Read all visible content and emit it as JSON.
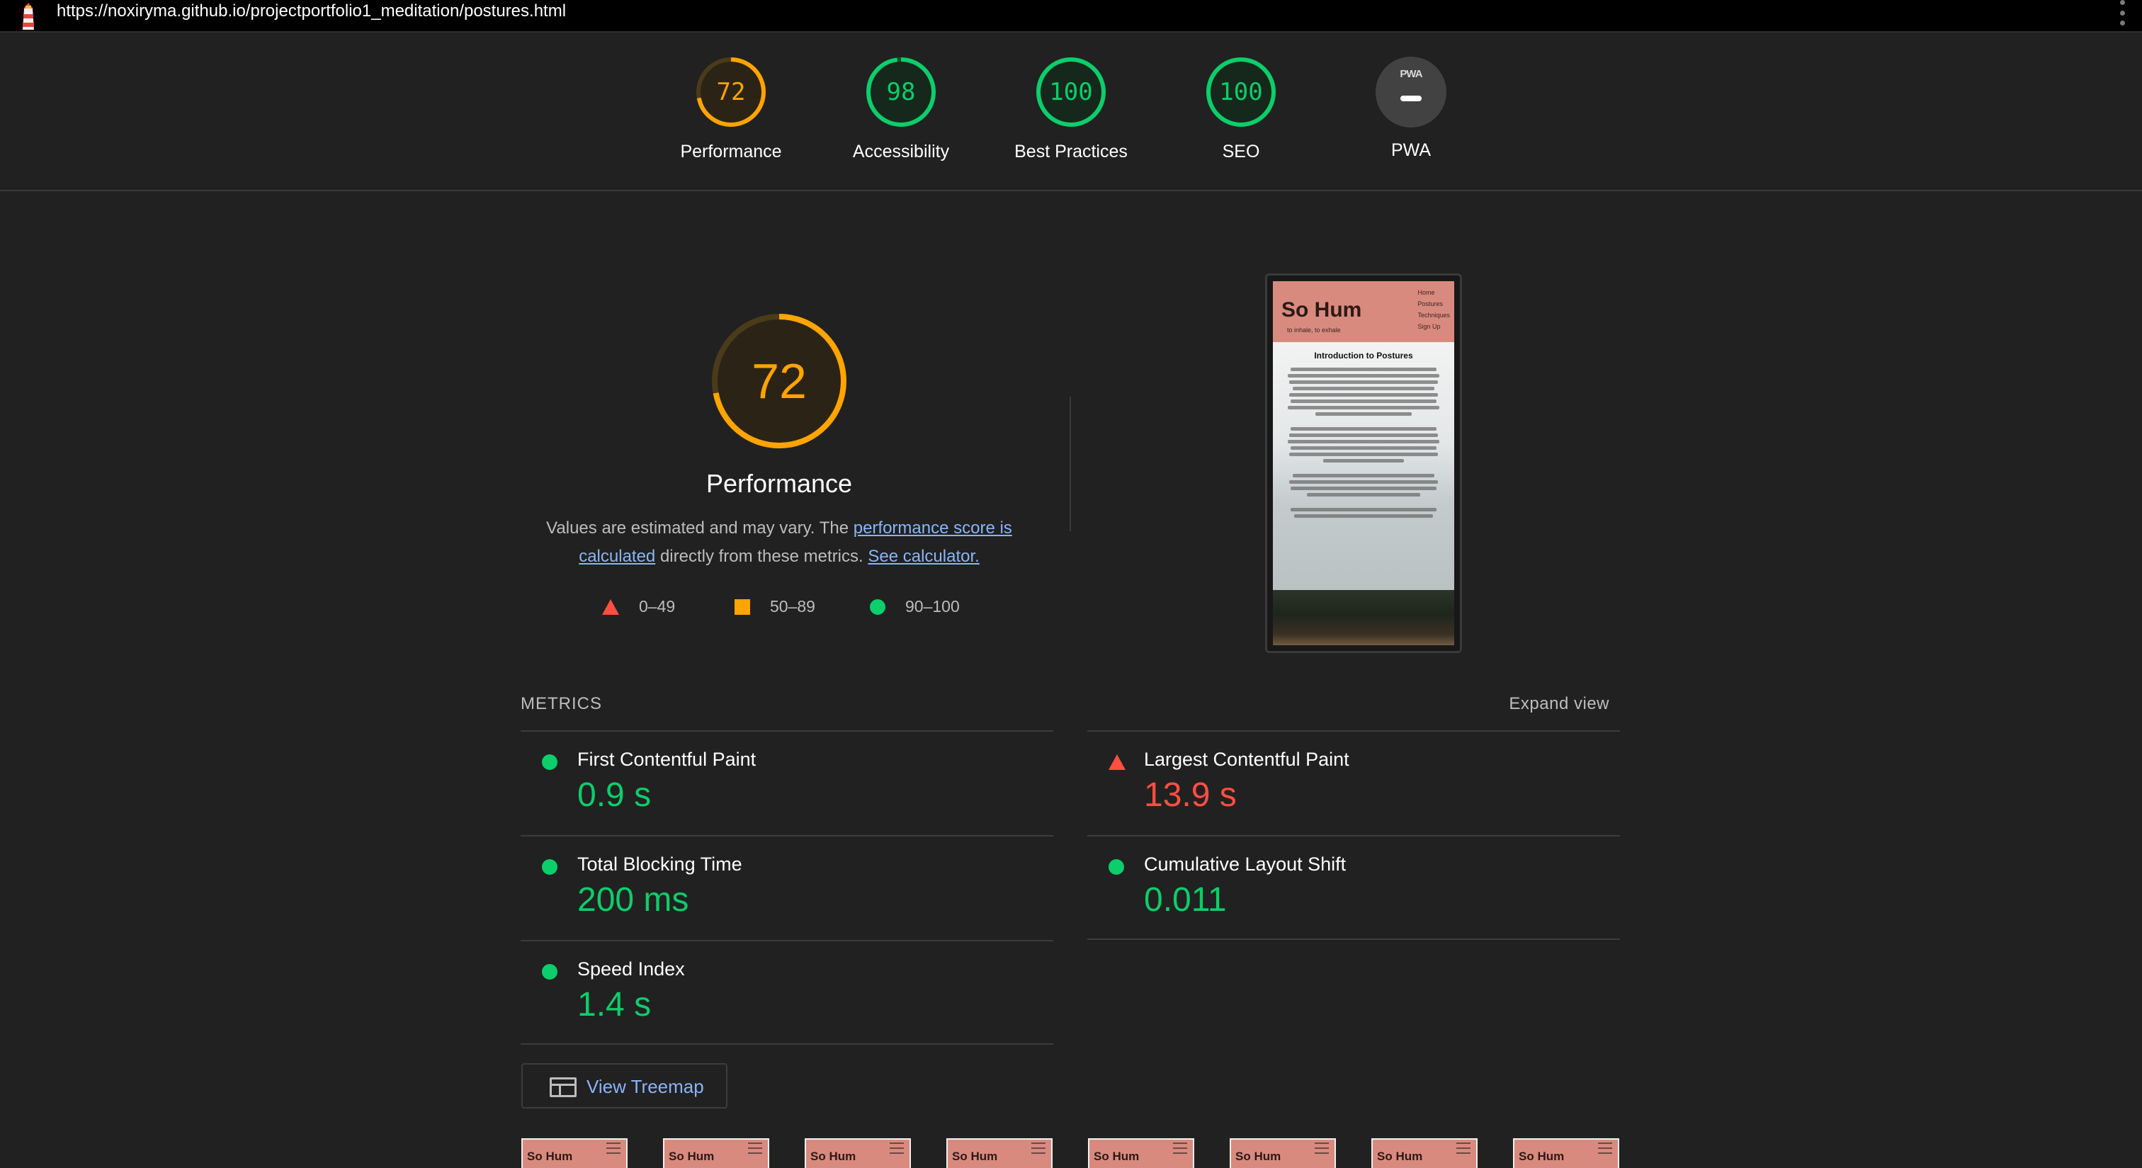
{
  "browser": {
    "url": "https://noxiryma.github.io/projectportfolio1_meditation/postures.html"
  },
  "categories": [
    {
      "label": "Performance",
      "score": "72",
      "color": "#ffa400",
      "fraction": 0.72
    },
    {
      "label": "Accessibility",
      "score": "98",
      "color": "#0cce6b",
      "fraction": 0.98
    },
    {
      "label": "Best Practices",
      "score": "100",
      "color": "#0cce6b",
      "fraction": 1.0
    },
    {
      "label": "SEO",
      "score": "100",
      "color": "#0cce6b",
      "fraction": 1.0
    },
    {
      "label": "PWA",
      "badge": "PWA",
      "color": "#424242"
    }
  ],
  "performance": {
    "score": "72",
    "fraction": 0.72,
    "title": "Performance",
    "desc_prefix": "Values are estimated and may vary. The ",
    "desc_link1": "performance score is calculated",
    "desc_middle": " directly from these metrics. ",
    "desc_link2": "See calculator.",
    "legend": [
      {
        "shape": "triangle",
        "label": "0–49",
        "color": "#ff4e42"
      },
      {
        "shape": "square",
        "label": "50–89",
        "color": "#ffa400"
      },
      {
        "shape": "circle",
        "label": "90–100",
        "color": "#0cce6b"
      }
    ]
  },
  "preview": {
    "brand": "So Hum",
    "tagline": "to inhale, to exhale",
    "nav": [
      "Home",
      "Postures",
      "Techniques",
      "Sign Up"
    ],
    "heading": "Introduction to Postures"
  },
  "metrics": {
    "title": "METRICS",
    "expand": "Expand view",
    "items": [
      {
        "name": "First Contentful Paint",
        "value": "0.9 s",
        "rating": "good"
      },
      {
        "name": "Largest Contentful Paint",
        "value": "13.9 s",
        "rating": "bad"
      },
      {
        "name": "Total Blocking Time",
        "value": "200 ms",
        "rating": "good"
      },
      {
        "name": "Cumulative Layout Shift",
        "value": "0.011",
        "rating": "good"
      },
      {
        "name": "Speed Index",
        "value": "1.4 s",
        "rating": "good"
      }
    ]
  },
  "treemap": {
    "label": "View Treemap"
  },
  "filmstrip": {
    "frame_label": "So Hum",
    "frames": 8
  },
  "colors": {
    "good": "#0cce6b",
    "average": "#ffa400",
    "bad": "#ff4e42",
    "link": "#8ab4f8"
  }
}
